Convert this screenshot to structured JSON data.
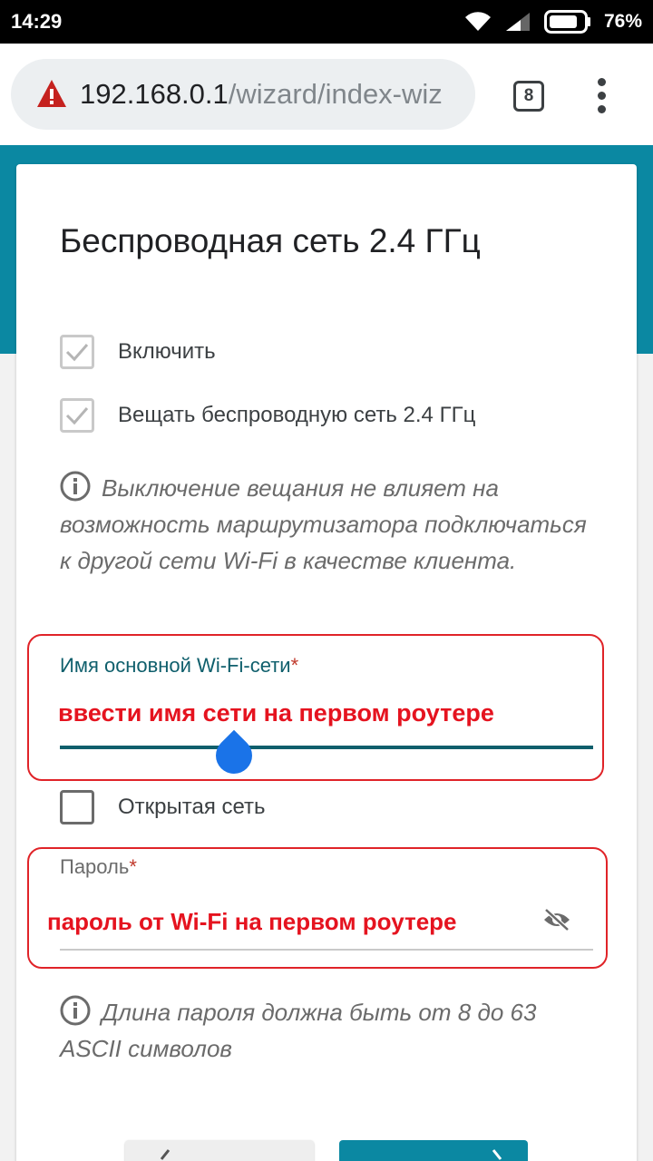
{
  "status_bar": {
    "time": "14:29",
    "battery_percent": "76%",
    "icons": [
      "wifi-icon",
      "signal-icon",
      "battery-icon"
    ]
  },
  "browser": {
    "url_host": "192.168.0.1",
    "url_path": "/wizard/index-wiz",
    "tab_count": "8",
    "security": "not-secure-warning-icon"
  },
  "page": {
    "title": "Беспроводная сеть 2.4 ГГц",
    "checkbox_enable": {
      "label": "Включить",
      "checked": true
    },
    "checkbox_broadcast": {
      "label": "Вещать беспроводную сеть 2.4 ГГц",
      "checked": true
    },
    "info_broadcast": "Выключение вещания не влияет на возможность маршрутизатора подключаться к другой сети Wi-Fi в качестве клиента.",
    "ssid_field": {
      "label": "Имя основной Wi-Fi-сети",
      "required_mark": "*",
      "annotation": "ввести имя сети на первом роутере"
    },
    "checkbox_open": {
      "label": "Открытая сеть",
      "checked": false
    },
    "password_field": {
      "label": "Пароль",
      "required_mark": "*",
      "annotation": "пароль от Wi-Fi на первом роутере"
    },
    "info_password": "Длина пароля должна быть от 8 до 63 ASCII символов"
  },
  "colors": {
    "accent": "#0b88a2",
    "field_label": "#0f5f6c",
    "annotation": "#e5131f",
    "cursor_handle": "#1a73e8"
  }
}
